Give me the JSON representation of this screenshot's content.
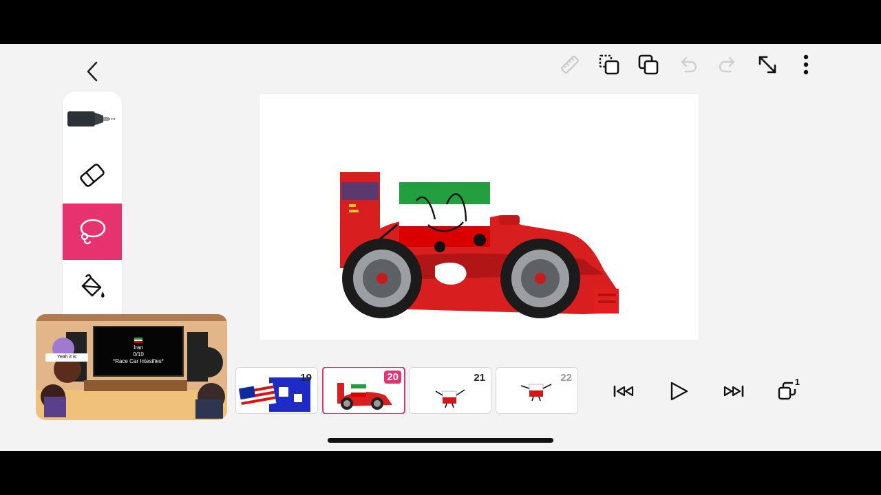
{
  "toolbar": {
    "icons": [
      "ruler-icon",
      "copy-layer-icon",
      "duplicate-icon",
      "undo-icon",
      "redo-icon",
      "expand-icon",
      "more-icon"
    ]
  },
  "tools": [
    {
      "name": "pen",
      "icon": "pen-icon",
      "active": false
    },
    {
      "name": "eraser",
      "icon": "eraser-icon",
      "active": false
    },
    {
      "name": "lasso",
      "icon": "lasso-icon",
      "active": true
    },
    {
      "name": "fill",
      "icon": "paint-bucket-icon",
      "active": false
    }
  ],
  "frames": [
    {
      "number": "19",
      "thumbnail": "flags"
    },
    {
      "number": "20",
      "thumbnail": "race-car",
      "selected": true
    },
    {
      "number": "21",
      "thumbnail": "character"
    },
    {
      "number": "22",
      "thumbnail": "character",
      "faded": true
    }
  ],
  "playback": {
    "layers_badge": "1"
  },
  "overlay": {
    "tv_line1": "Iran",
    "tv_line2": "0/10",
    "tv_line3": "*Race Car Intesifies*",
    "speech_bubble": "Yeah it is"
  },
  "colors": {
    "accent": "#e6336f",
    "car_red": "#d81e1e",
    "flag_green": "#239f40",
    "flag_red": "#da0000"
  }
}
